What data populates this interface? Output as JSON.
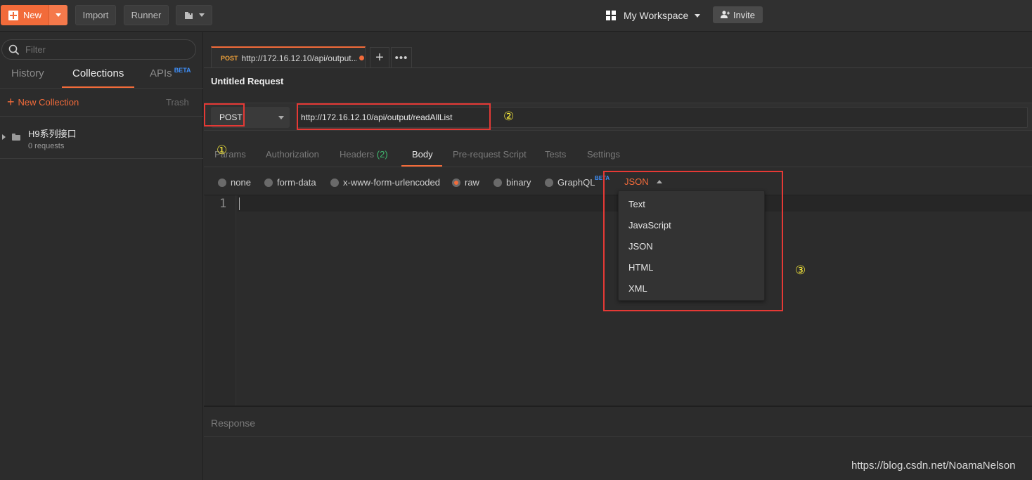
{
  "topbar": {
    "new_label": "New",
    "import_label": "Import",
    "runner_label": "Runner",
    "workspace_label": "My Workspace",
    "invite_label": "Invite"
  },
  "sidebar": {
    "filter_placeholder": "Filter",
    "tabs": [
      {
        "label": "History",
        "active": false
      },
      {
        "label": "Collections",
        "active": true
      },
      {
        "label": "APIs",
        "badge": "BETA",
        "active": false
      }
    ],
    "new_collection_label": "New Collection",
    "trash_label": "Trash",
    "collections": [
      {
        "name": "H9系列接口",
        "count": "0 requests"
      }
    ]
  },
  "request_tab": {
    "method": "POST",
    "url_short": "http://172.16.12.10/api/output..."
  },
  "request": {
    "title": "Untitled Request",
    "method": "POST",
    "url": "http://172.16.12.10/api/output/readAllList"
  },
  "request_subtabs": [
    {
      "label": "Params",
      "active": false
    },
    {
      "label": "Authorization",
      "active": false
    },
    {
      "label": "Headers",
      "count": "(2)",
      "active": false
    },
    {
      "label": "Body",
      "active": true
    },
    {
      "label": "Pre-request Script",
      "active": false
    },
    {
      "label": "Tests",
      "active": false
    },
    {
      "label": "Settings",
      "active": false
    }
  ],
  "body_options": [
    {
      "label": "none",
      "selected": false
    },
    {
      "label": "form-data",
      "selected": false
    },
    {
      "label": "x-www-form-urlencoded",
      "selected": false
    },
    {
      "label": "raw",
      "selected": true
    },
    {
      "label": "binary",
      "selected": false
    },
    {
      "label": "GraphQL",
      "badge": "BETA",
      "selected": false
    }
  ],
  "format_select": {
    "selected": "JSON",
    "options": [
      "Text",
      "JavaScript",
      "JSON",
      "HTML",
      "XML"
    ]
  },
  "editor": {
    "line_number": "1"
  },
  "response_label": "Response",
  "annotations": [
    "①",
    "②",
    "③"
  ],
  "watermark": "https://blog.csdn.net/NoamaNelson",
  "colors": {
    "accent": "#f26b3a",
    "highlight_box": "#e53935",
    "annotation": "#f2e43a",
    "beta": "#3e8ef7",
    "headers_count": "#3fb96f"
  },
  "icons": [
    "plus-icon",
    "chevron-down-icon",
    "grid-icon",
    "add-user-icon",
    "search-icon",
    "folder-icon",
    "triangle-right-icon",
    "more-icon",
    "chevron-up-icon",
    "new-window-icon"
  ]
}
